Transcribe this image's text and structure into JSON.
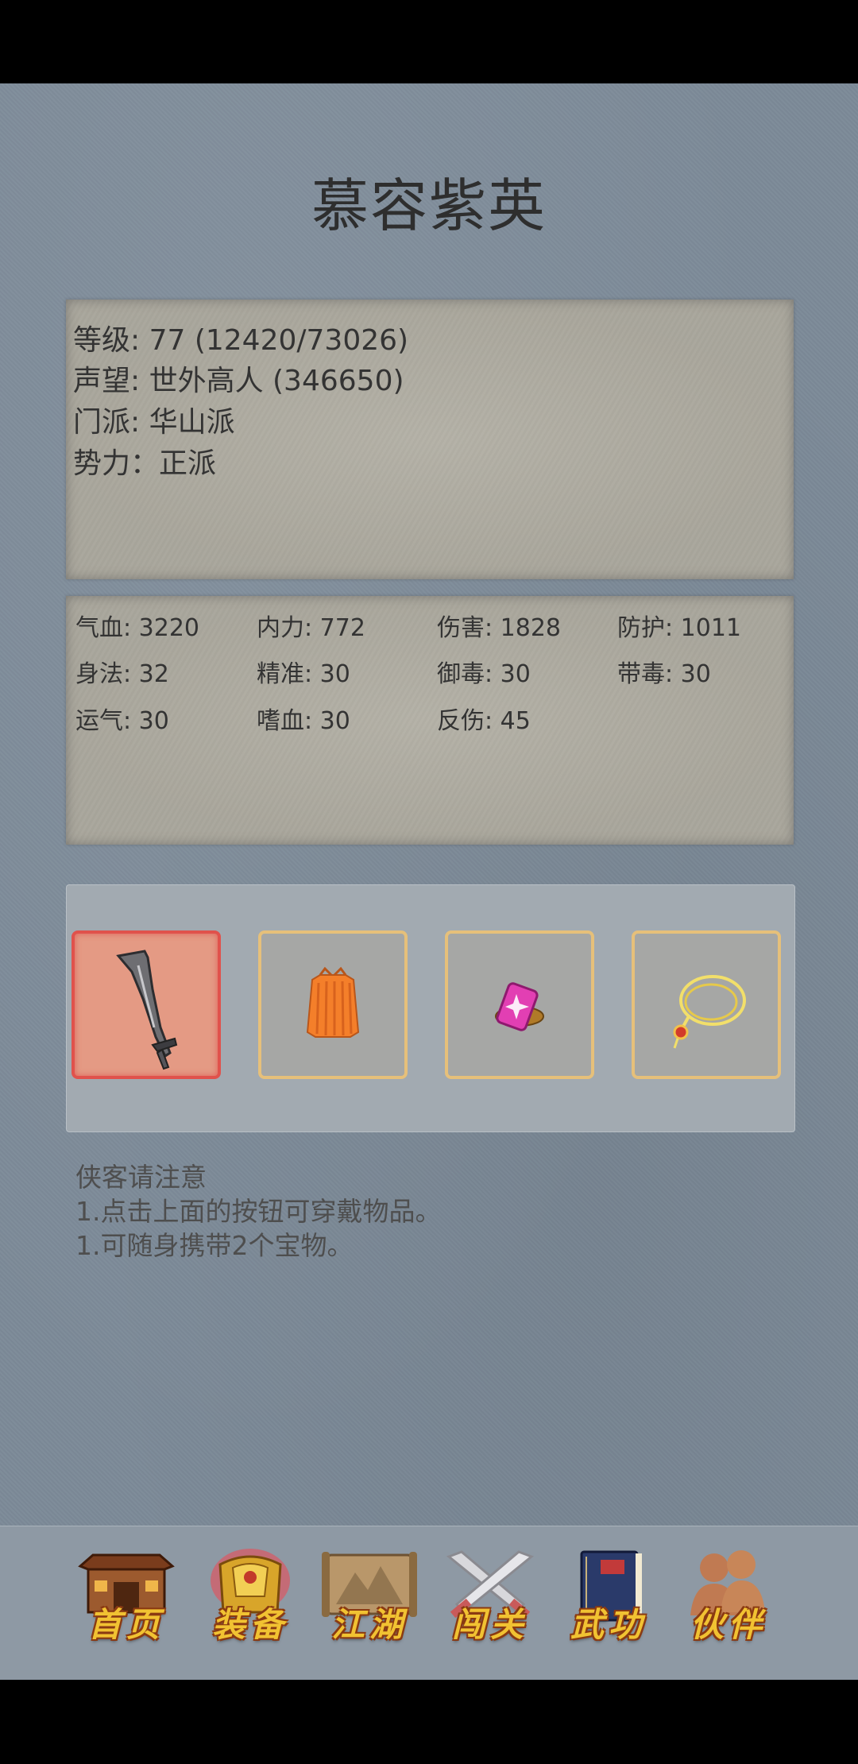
{
  "character": {
    "name": "慕容紫英",
    "level_line": "等级: 77 (12420/73026)",
    "fame_line": "声望: 世外高人 (346650)",
    "sect_line": "门派: 华山派",
    "faction_line": "势力：正派"
  },
  "stats": [
    "气血: 3220",
    "内力: 772",
    "伤害: 1828",
    "防护: 1011",
    "身法: 32",
    "精准: 30",
    "御毒: 30",
    "带毒: 30",
    "运气: 30",
    "嗜血: 30",
    "反伤: 45"
  ],
  "equipment": [
    {
      "icon": "sword-icon",
      "selected": true
    },
    {
      "icon": "armor-vest-icon",
      "selected": false
    },
    {
      "icon": "pink-gem-icon",
      "selected": false
    },
    {
      "icon": "necklace-icon",
      "selected": false
    }
  ],
  "notice": {
    "title": "侠客请注意",
    "line1": "1.点击上面的按钮可穿戴物品。",
    "line2": "1.可随身携带2个宝物。"
  },
  "nav": [
    {
      "label": "首页",
      "icon": "house-icon"
    },
    {
      "label": "装备",
      "icon": "armor-icon",
      "active": true
    },
    {
      "label": "江湖",
      "icon": "scroll-map-icon"
    },
    {
      "label": "闯关",
      "icon": "crossed-swords-icon"
    },
    {
      "label": "武功",
      "icon": "book-icon"
    },
    {
      "label": "伙伴",
      "icon": "partners-icon"
    }
  ],
  "colors": {
    "background": "#7c8a98",
    "panel": "#b0ada2",
    "nav_text": "#f1c232",
    "selected_slot": "#e49a84"
  }
}
